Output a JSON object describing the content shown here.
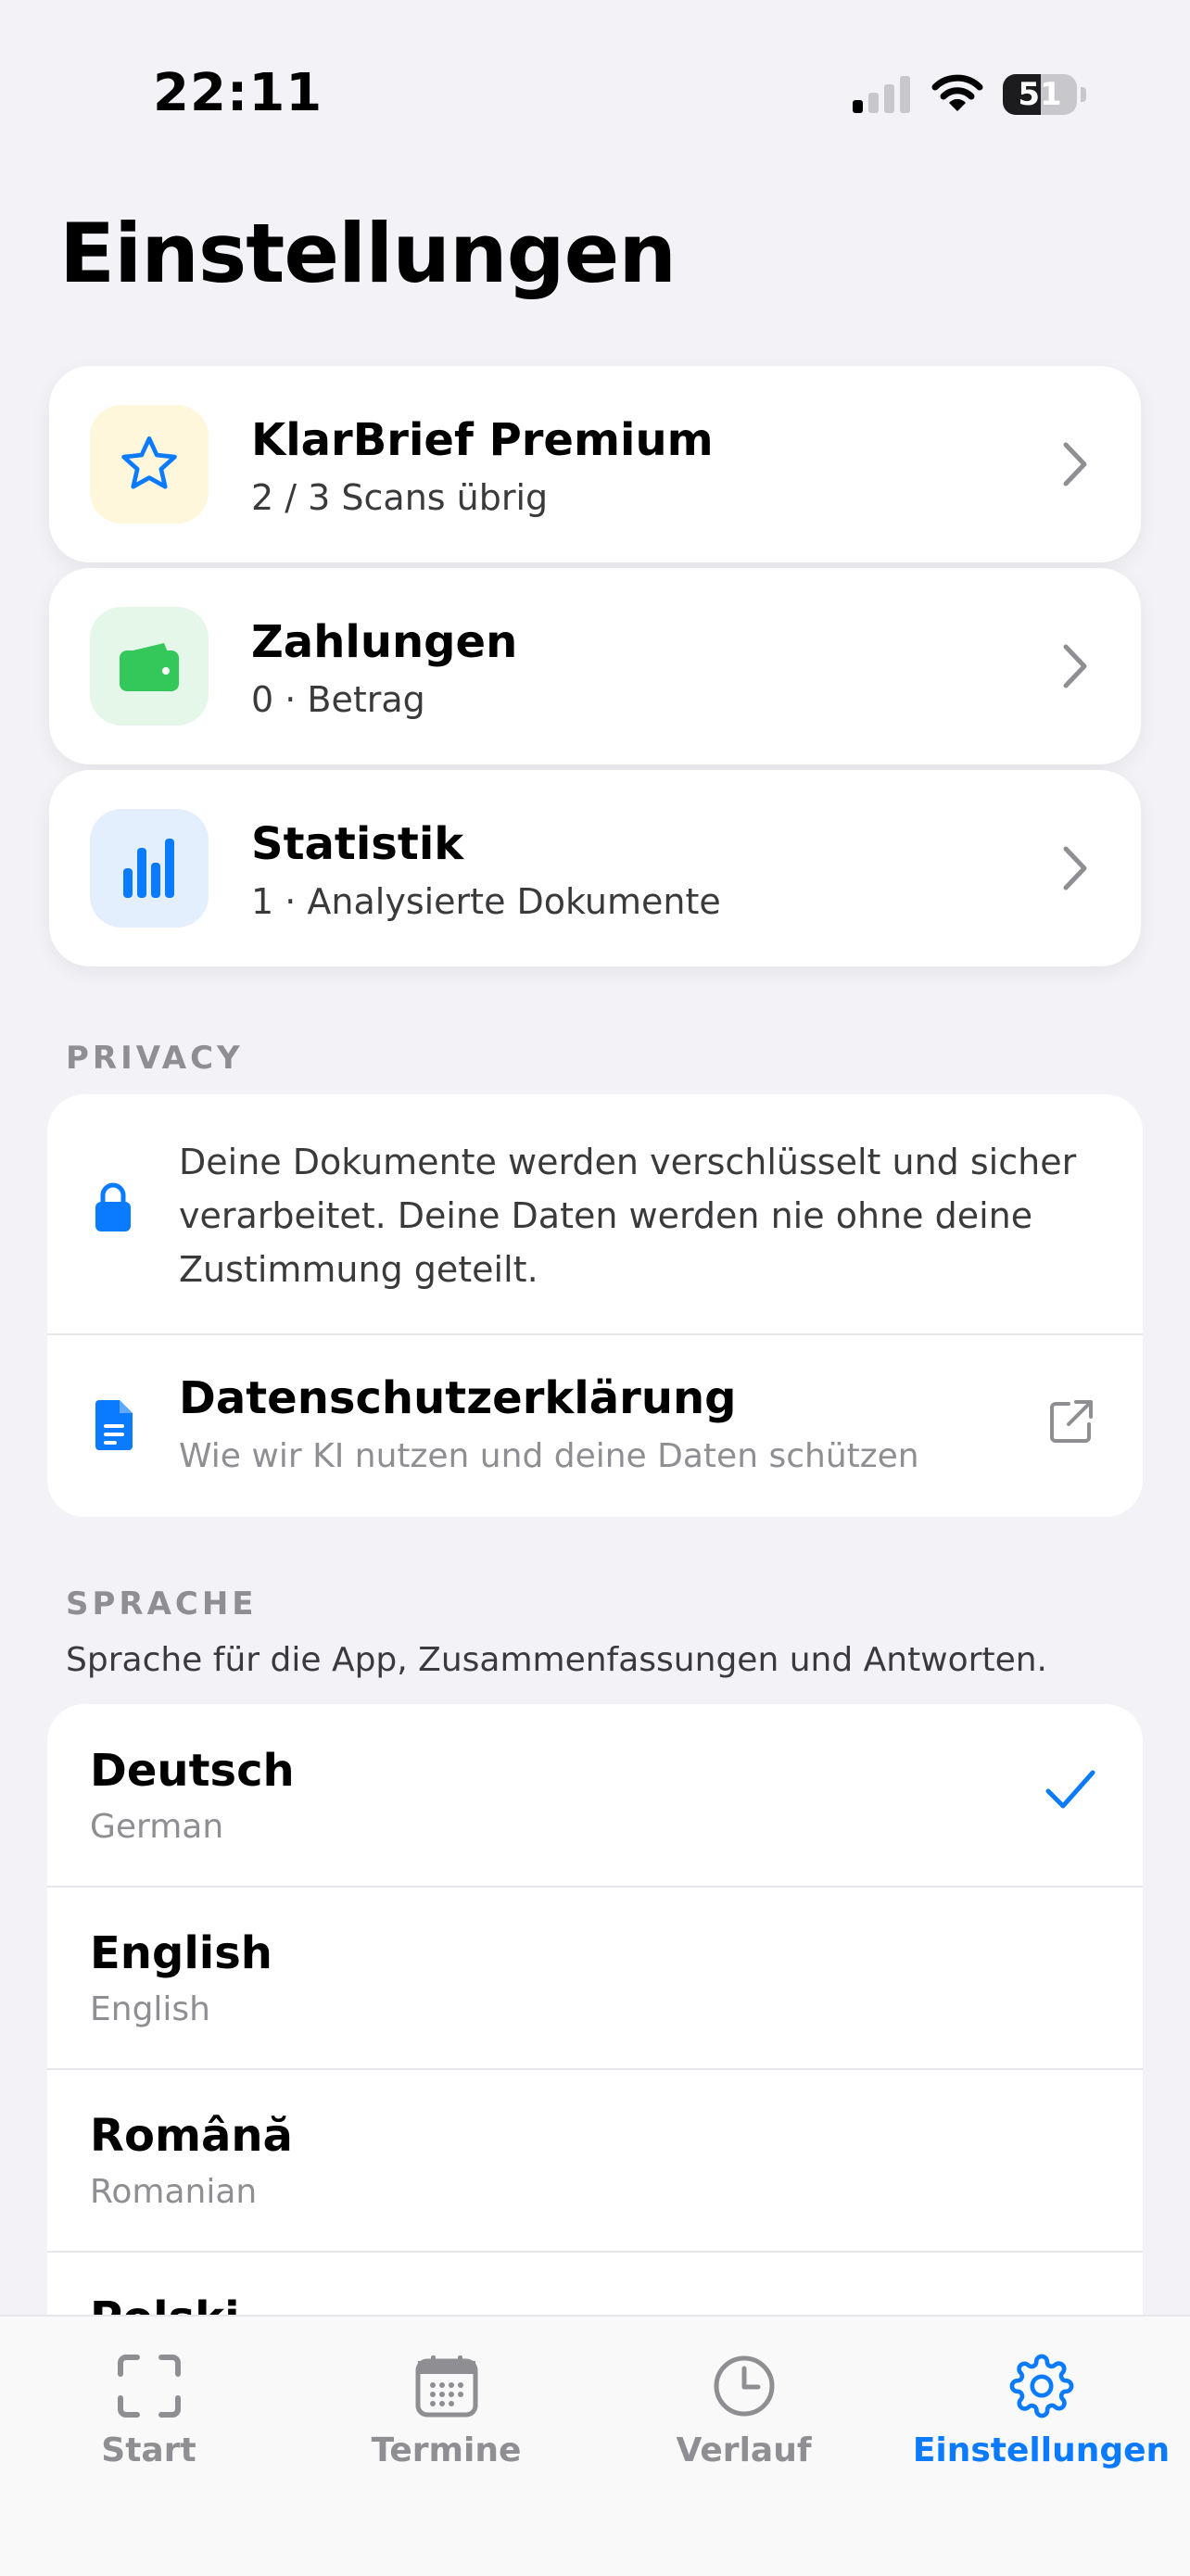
{
  "status_bar": {
    "time": "22:11",
    "battery": "51",
    "battery_level": 0.51
  },
  "page_title": "Einstellungen",
  "menu_cards": [
    {
      "title": "KlarBrief Premium",
      "subtitle": "2 / 3 Scans übrig",
      "icon": "star-icon",
      "icon_bg": "#fef7dc",
      "icon_color": "#0a7aff"
    },
    {
      "title": "Zahlungen",
      "subtitle": "0 · Betrag",
      "icon": "wallet-icon",
      "icon_bg": "#e4f7e9",
      "icon_color": "#34c759"
    },
    {
      "title": "Statistik",
      "subtitle": "1 · Analysierte Dokumente",
      "icon": "bar-chart-icon",
      "icon_bg": "#e4effd",
      "icon_color": "#0a7aff"
    }
  ],
  "privacy": {
    "header": "PRIVACY",
    "text": "Deine Dokumente werden verschlüsselt und sicher verarbeitet. Deine Daten werden nie ohne deine Zustimmung geteilt.",
    "policy_title": "Datenschutzerklärung",
    "policy_subtitle": "Wie wir KI nutzen und deine Daten schützen"
  },
  "language": {
    "header": "SPRACHE",
    "description": "Sprache für die App, Zusammenfassungen und Antworten.",
    "options": [
      {
        "name": "Deutsch",
        "native": "German",
        "selected": true
      },
      {
        "name": "English",
        "native": "English",
        "selected": false
      },
      {
        "name": "Română",
        "native": "Romanian",
        "selected": false
      },
      {
        "name": "Polski",
        "native": "",
        "selected": false
      }
    ]
  },
  "tab_bar": {
    "tabs": [
      {
        "label": "Start",
        "icon": "scan-icon",
        "active": false
      },
      {
        "label": "Termine",
        "icon": "calendar-icon",
        "active": false
      },
      {
        "label": "Verlauf",
        "icon": "clock-icon",
        "active": false
      },
      {
        "label": "Einstellungen",
        "icon": "gear-icon",
        "active": true
      }
    ]
  },
  "colors": {
    "accent": "#0a7aff",
    "green": "#34c759",
    "background": "#f2f2f7"
  }
}
